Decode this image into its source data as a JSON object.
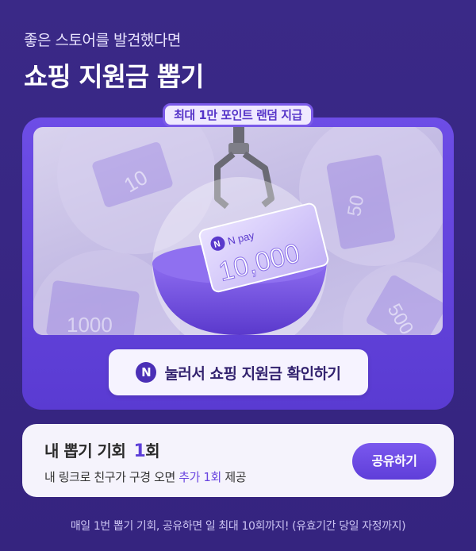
{
  "header": {
    "subtitle": "좋은 스토어를 발견했다면",
    "title": "쇼핑 지원금 뽑기"
  },
  "badge": {
    "label": "최대 1만 포인트 랜덤 지급"
  },
  "scene": {
    "ticket_main_brand": "N pay",
    "ticket_main_amount": "10,000",
    "ticket_values": [
      "10",
      "50",
      "1000",
      "500"
    ]
  },
  "cta": {
    "logo": "N",
    "label": "눌러서 쇼핑 지원금 확인하기"
  },
  "chance": {
    "title_prefix": "내 뽑기 기회",
    "count": "1",
    "unit": "회",
    "desc_prefix": "내 링크로 친구가 구경 오면",
    "desc_highlight": "추가 1회",
    "desc_suffix": "제공",
    "share_label": "공유하기"
  },
  "footer": {
    "note": "매일 1번 뽑기 기회, 공유하면 일 최대 10회까지! (유효기간 당일 자정까지)"
  },
  "colors": {
    "background": "#3b2a8c",
    "accent": "#5d3fd8",
    "card": "#6d4de6"
  }
}
